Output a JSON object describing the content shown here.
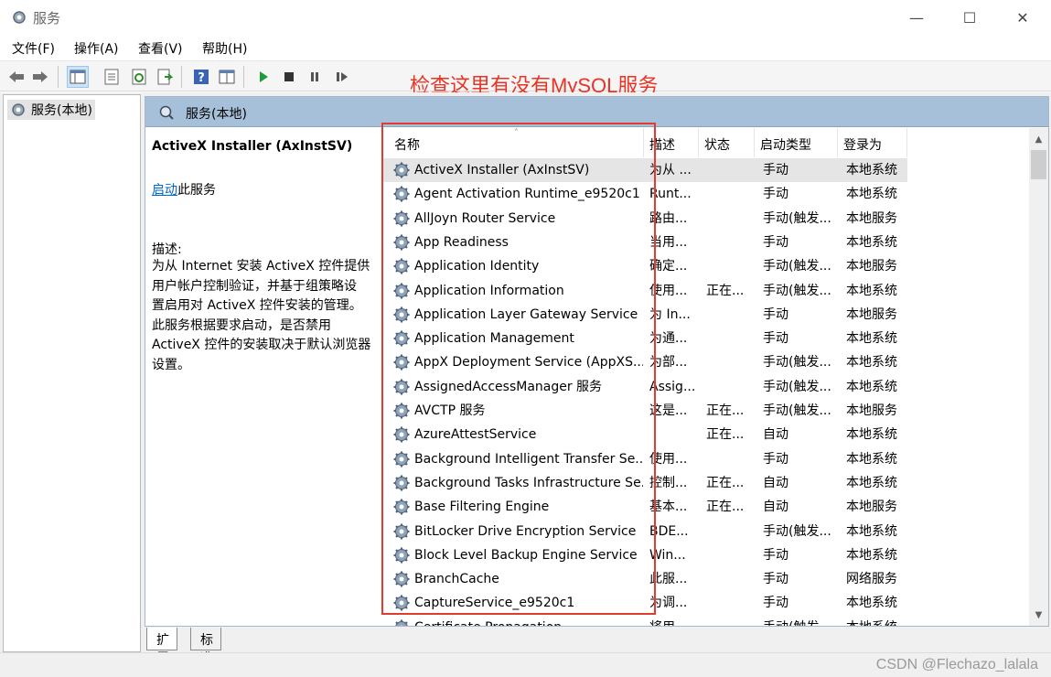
{
  "window": {
    "title": "服务",
    "minimize_glyph": "—",
    "maximize_glyph": "☐",
    "close_glyph": "✕"
  },
  "menu": [
    "文件(F)",
    "操作(A)",
    "查看(V)",
    "帮助(H)"
  ],
  "toolbar": {
    "buttons": [
      "back-icon",
      "forward-icon",
      "show-hide-tree-icon",
      "properties-icon",
      "refresh-icon",
      "export-list-icon",
      "help-icon",
      "view-icon",
      "start-service-icon",
      "stop-service-icon",
      "pause-service-icon",
      "restart-service-icon"
    ]
  },
  "annotation": "检查这里有没有MySQL服务",
  "tree": {
    "root_label": "服务(本地)"
  },
  "panel": {
    "header_title": "服务(本地)"
  },
  "details": {
    "service_name": "ActiveX Installer (AxInstSV)",
    "start_link": "启动",
    "start_suffix": "此服务",
    "desc_label": "描述:",
    "desc_text": "为从 Internet 安装 ActiveX 控件提供\n用户帐户控制验证，并基于组策略设\n置启用对 ActiveX 控件安装的管理。\n此服务根据要求启动，是否禁用\nActiveX 控件的安装取决于默认浏览器\n设置。"
  },
  "columns": {
    "name": "名称",
    "desc": "描述",
    "status": "状态",
    "startup": "启动类型",
    "logon": "登录为"
  },
  "sort_indicator": "˄",
  "services": [
    {
      "name": "ActiveX Installer (AxInstSV)",
      "desc": "为从 ...",
      "status": "",
      "startup": "手动",
      "logon": "本地系统"
    },
    {
      "name": "Agent Activation Runtime_e9520c1",
      "desc": "Runt...",
      "status": "",
      "startup": "手动",
      "logon": "本地系统"
    },
    {
      "name": "AllJoyn Router Service",
      "desc": "路由...",
      "status": "",
      "startup": "手动(触发...",
      "logon": "本地服务"
    },
    {
      "name": "App Readiness",
      "desc": "当用...",
      "status": "",
      "startup": "手动",
      "logon": "本地系统"
    },
    {
      "name": "Application Identity",
      "desc": "确定...",
      "status": "",
      "startup": "手动(触发...",
      "logon": "本地服务"
    },
    {
      "name": "Application Information",
      "desc": "使用...",
      "status": "正在...",
      "startup": "手动(触发...",
      "logon": "本地系统"
    },
    {
      "name": "Application Layer Gateway Service",
      "desc": "为 In...",
      "status": "",
      "startup": "手动",
      "logon": "本地服务"
    },
    {
      "name": "Application Management",
      "desc": "为通...",
      "status": "",
      "startup": "手动",
      "logon": "本地系统"
    },
    {
      "name": "AppX Deployment Service (AppXS...",
      "desc": "为部...",
      "status": "",
      "startup": "手动(触发...",
      "logon": "本地系统"
    },
    {
      "name": "AssignedAccessManager 服务",
      "desc": "Assig...",
      "status": "",
      "startup": "手动(触发...",
      "logon": "本地系统"
    },
    {
      "name": "AVCTP 服务",
      "desc": "这是...",
      "status": "正在...",
      "startup": "手动(触发...",
      "logon": "本地服务"
    },
    {
      "name": "AzureAttestService",
      "desc": "",
      "status": "正在...",
      "startup": "自动",
      "logon": "本地系统"
    },
    {
      "name": "Background Intelligent Transfer Se...",
      "desc": "使用...",
      "status": "",
      "startup": "手动",
      "logon": "本地系统"
    },
    {
      "name": "Background Tasks Infrastructure Se...",
      "desc": "控制...",
      "status": "正在...",
      "startup": "自动",
      "logon": "本地系统"
    },
    {
      "name": "Base Filtering Engine",
      "desc": "基本...",
      "status": "正在...",
      "startup": "自动",
      "logon": "本地服务"
    },
    {
      "name": "BitLocker Drive Encryption Service",
      "desc": "BDE...",
      "status": "",
      "startup": "手动(触发...",
      "logon": "本地系统"
    },
    {
      "name": "Block Level Backup Engine Service",
      "desc": "Win...",
      "status": "",
      "startup": "手动",
      "logon": "本地系统"
    },
    {
      "name": "BranchCache",
      "desc": "此服...",
      "status": "",
      "startup": "手动",
      "logon": "网络服务"
    },
    {
      "name": "CaptureService_e9520c1",
      "desc": "为调...",
      "status": "",
      "startup": "手动",
      "logon": "本地系统"
    },
    {
      "name": "Certificate Propagation",
      "desc": "将用...",
      "status": "",
      "startup": "手动(触发...",
      "logon": "本地系统"
    }
  ],
  "selected_service": "ActiveX Installer (AxInstSV)",
  "tabs": [
    "扩展",
    "标准"
  ],
  "active_tab": "扩展",
  "watermark": "CSDN @Flechazo_lalala",
  "colors": {
    "annotation": "#ea3323",
    "header_bar": "#a7c0d9",
    "link": "#0066cc"
  }
}
